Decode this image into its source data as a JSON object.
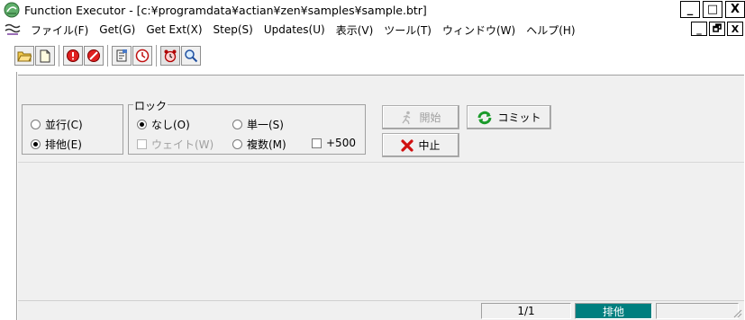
{
  "window": {
    "title": "Function Executor - [c:¥programdata¥actian¥zen¥samples¥sample.btr]",
    "title_buttons": [
      "_",
      "□",
      "X"
    ]
  },
  "menubar": {
    "items": [
      {
        "label": "ファイル(F)"
      },
      {
        "label": "Get(G)"
      },
      {
        "label": "Get Ext(X)"
      },
      {
        "label": "Step(S)"
      },
      {
        "label": "Updates(U)"
      },
      {
        "label": "表示(V)"
      },
      {
        "label": "ツール(T)"
      },
      {
        "label": "ウィンドウ(W)"
      },
      {
        "label": "ヘルプ(H)"
      }
    ],
    "mdi_buttons": [
      "_",
      "🗗",
      "X"
    ]
  },
  "toolbar": {
    "icons": [
      "open-folder-icon",
      "new-file-icon",
      "reset-icon",
      "stop-icon",
      "properties-icon",
      "timer-icon",
      "alarm-clock-icon",
      "search-icon"
    ]
  },
  "transaction": {
    "concurrent": "並行(C)",
    "exclusive": "排他(E)",
    "selected": "exclusive"
  },
  "lock": {
    "legend": "ロック",
    "none": "なし(O)",
    "single": "単一(S)",
    "wait": "ウェイト(W)",
    "multiple": "複数(M)",
    "plus500": "+500",
    "selected": "none"
  },
  "buttons": {
    "start": "開始",
    "commit": "コミット",
    "abort": "中止"
  },
  "statusbar": {
    "position": "1/1",
    "mode": "排他"
  },
  "colors": {
    "status_teal": "#007f7f",
    "abort_red": "#d01010",
    "commit_green": "#1a9a2a"
  }
}
